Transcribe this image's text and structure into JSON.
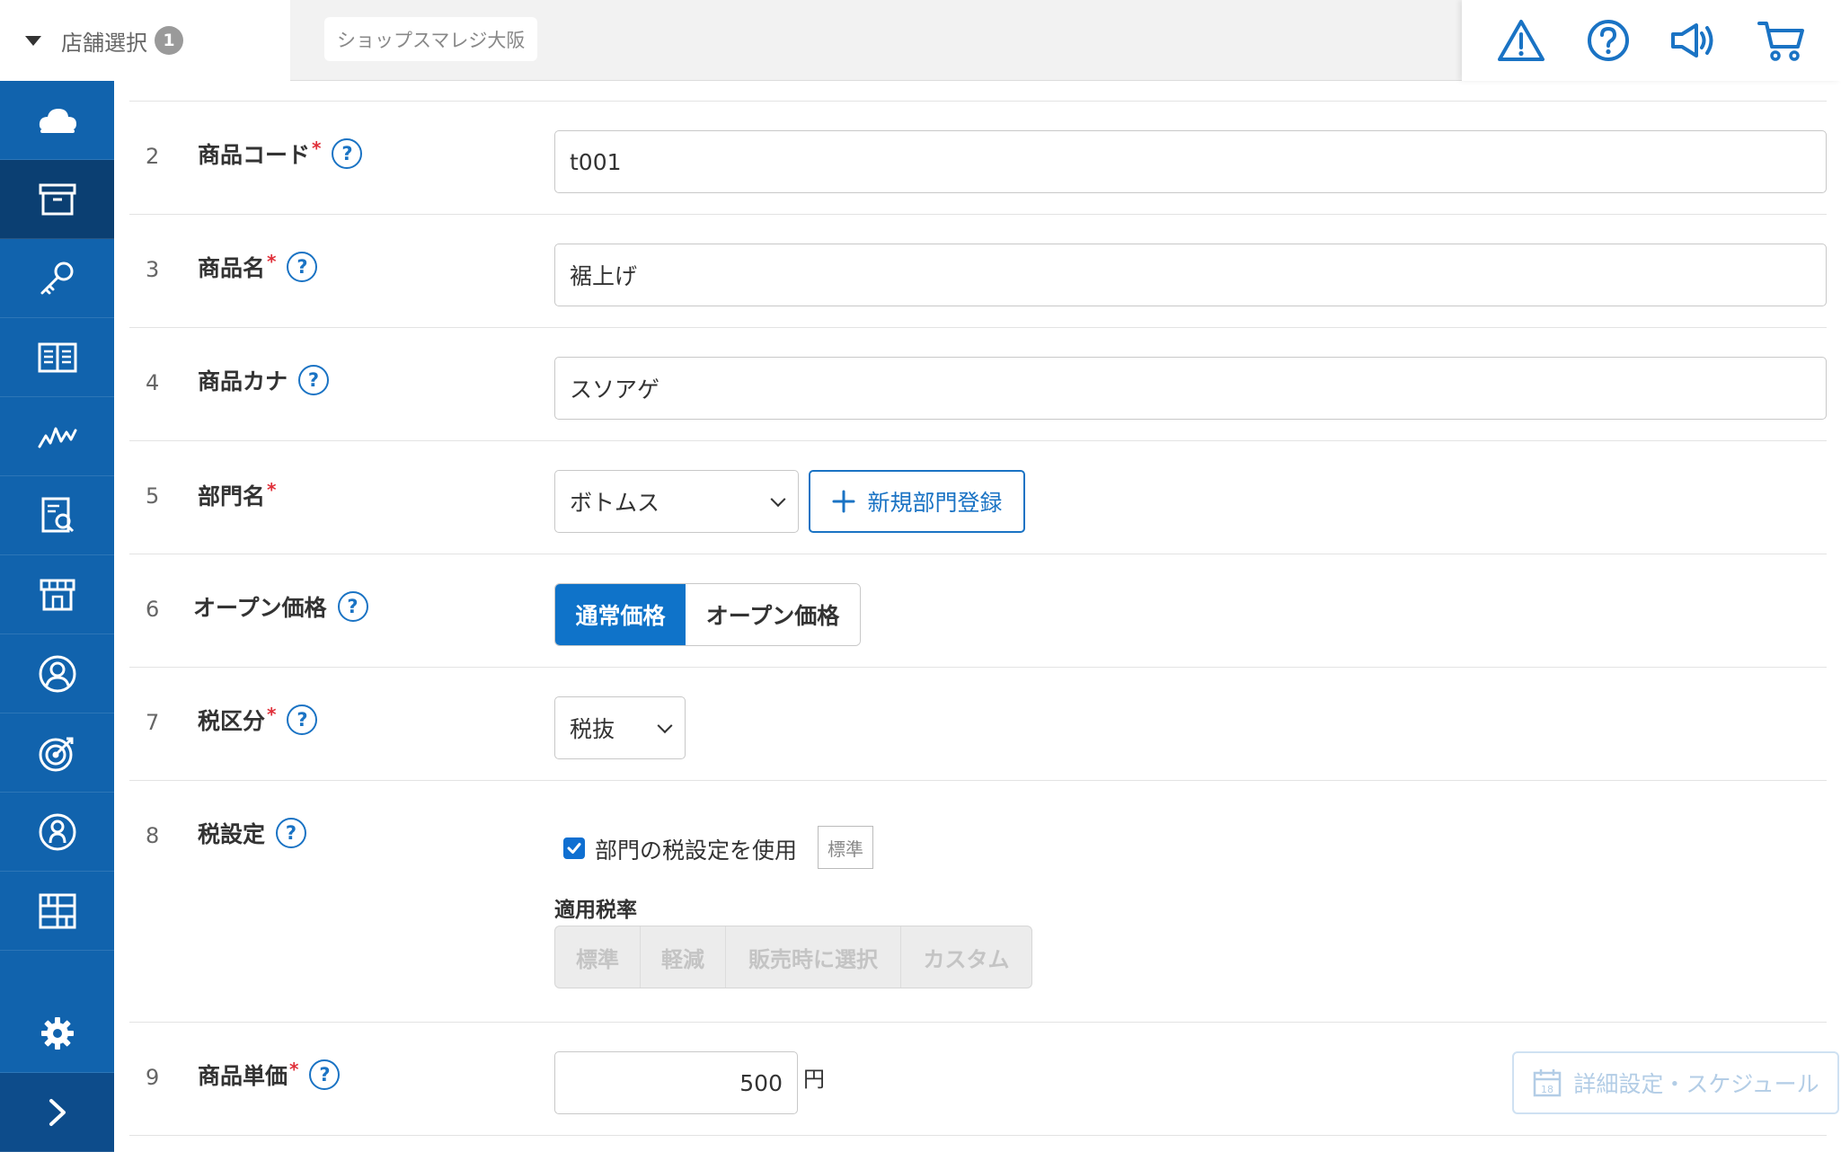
{
  "header": {
    "store_select_label": "店舗選択",
    "store_count": "1",
    "shop_name": "ショップスマレジ大阪"
  },
  "header_icons": [
    "alert-icon",
    "help-icon",
    "announcement-icon",
    "cart-icon"
  ],
  "sidebar": {
    "items": [
      "cloud-icon",
      "product-box-icon",
      "key-icon",
      "book-icon",
      "analytics-icon",
      "report-icon",
      "store-icon",
      "customer-icon",
      "target-icon",
      "staff-icon",
      "grid-icon"
    ],
    "active_index": 1,
    "bottom": [
      "settings-gear-icon",
      "expand-chevron-icon"
    ]
  },
  "colors": {
    "sidebar_bg": "#1163ad",
    "sidebar_active": "#0b3f72",
    "accent": "#1a73c4",
    "required": "#e0303a"
  },
  "form": {
    "product_code": {
      "num": "2",
      "label": "商品コード",
      "required": "*",
      "help": "?",
      "value": "t001"
    },
    "product_name": {
      "num": "3",
      "label": "商品名",
      "required": "*",
      "help": "?",
      "value": "裾上げ"
    },
    "product_kana": {
      "num": "4",
      "label": "商品カナ",
      "help": "?",
      "value": "スソアゲ"
    },
    "department": {
      "num": "5",
      "label": "部門名",
      "required": "*",
      "selected": "ボトムス",
      "add_button": "新規部門登録"
    },
    "open_price": {
      "num": "6",
      "label": "オープン価格",
      "help": "?",
      "option_normal": "通常価格",
      "option_open": "オープン価格",
      "selected": "通常価格"
    },
    "tax_category": {
      "num": "7",
      "label": "税区分",
      "required": "*",
      "help": "?",
      "selected": "税抜"
    },
    "tax_setting": {
      "num": "8",
      "label": "税設定",
      "help": "?",
      "checkbox_label": "部門の税設定を使用",
      "checked": true,
      "tag": "標準",
      "rate_heading": "適用税率",
      "rate_options": [
        "標準",
        "軽減",
        "販売時に選択",
        "カスタム"
      ]
    },
    "unit_price": {
      "num": "9",
      "label": "商品単価",
      "required": "*",
      "help": "?",
      "value": "500",
      "unit": "円",
      "schedule_button": "詳細設定・スケジュール"
    }
  }
}
